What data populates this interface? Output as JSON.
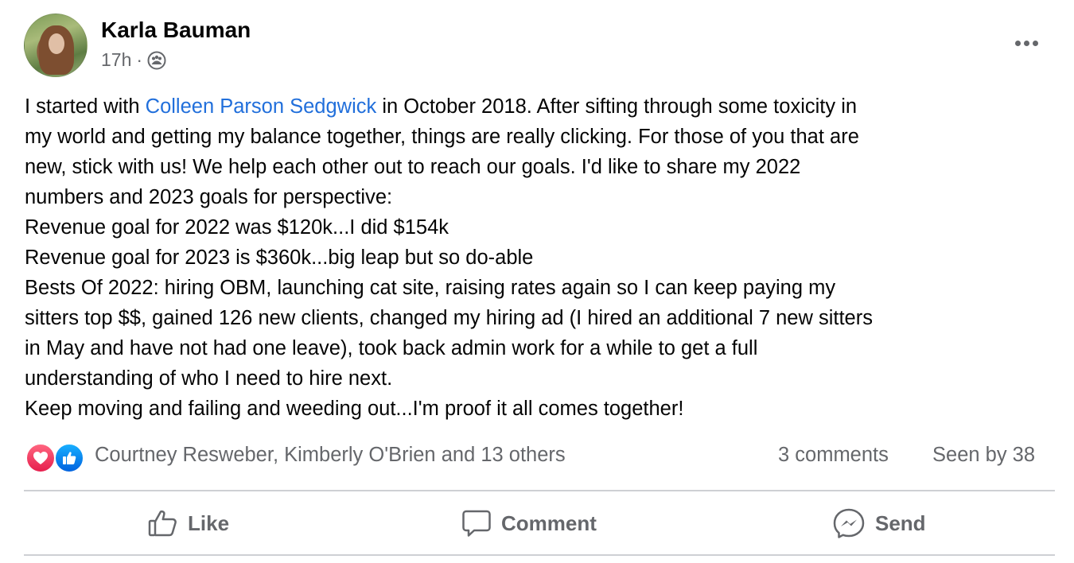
{
  "post": {
    "author": "Karla Bauman",
    "time": "17h",
    "separator": "·",
    "audience_icon": "group-audience-icon",
    "more_icon": "more-options-icon",
    "text": {
      "line1_before": "I started with ",
      "mention": "Colleen Parson Sedgwick",
      "line1_after": " in October 2018. After sifting through some toxicity in",
      "lines": [
        "my world and getting my balance together, things are really clicking. For those of you that are",
        "new, stick with us! We help each other out to reach our goals. I'd like to share my 2022",
        "numbers and 2023 goals for perspective:",
        "Revenue goal for 2022 was $120k...I did $154k",
        "Revenue goal for 2023 is $360k...big leap but so do-able",
        "Bests Of 2022: hiring OBM, launching cat site, raising rates again so I can keep paying my",
        "sitters top $$, gained 126 new clients, changed my hiring ad (I hired an additional 7 new sitters",
        "in May and have not had one leave), took back admin work for a while to get a full",
        "understanding of who I need to hire next.",
        "Keep moving and failing and weeding out...I'm proof it all comes together!"
      ]
    },
    "reactions": {
      "types": [
        "love",
        "like"
      ],
      "summary": "Courtney Resweber, Kimberly O'Brien and 13 others",
      "comments": "3 comments",
      "seen_by": "Seen by 38"
    },
    "actions": {
      "like": "Like",
      "comment": "Comment",
      "send": "Send"
    }
  },
  "colors": {
    "text": "#050505",
    "secondary": "#65676b",
    "link": "#216fdb",
    "divider": "#ced0d4",
    "love": "#e61e4d",
    "like": "#0062df"
  }
}
